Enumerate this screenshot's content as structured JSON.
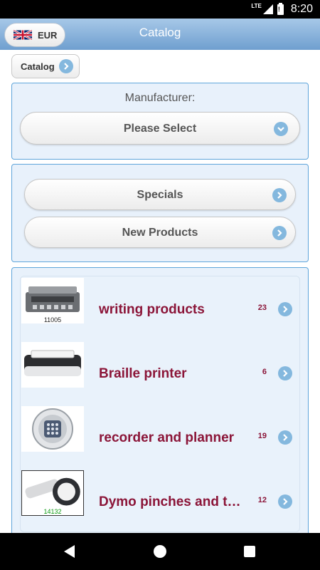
{
  "status_bar": {
    "network": "LTE",
    "battery_level": "!",
    "time": "8:20"
  },
  "app_bar": {
    "title": "Catalog",
    "currency": "EUR",
    "flag_icon": "uk-flag-icon"
  },
  "breadcrumb": {
    "label": "Catalog"
  },
  "manufacturer": {
    "label": "Manufacturer:",
    "selected": "Please Select"
  },
  "links": {
    "specials": "Specials",
    "new_products": "New Products"
  },
  "categories": [
    {
      "name": "writing products",
      "count": "23",
      "thumb_code": "11005",
      "icon": "braille-writer-icon"
    },
    {
      "name": "Braille printer",
      "count": "6",
      "thumb_code": "",
      "icon": "braille-printer-icon"
    },
    {
      "name": "recorder and planner",
      "count": "19",
      "thumb_code": "",
      "icon": "recorder-icon"
    },
    {
      "name": "Dymo pinches and ta…",
      "count": "12",
      "thumb_code": "14132",
      "icon": "dymo-labeler-icon"
    }
  ],
  "colors": {
    "accent": "#84b8de",
    "category_text": "#8b1538",
    "panel_border": "#5fa5da",
    "appbar": "#6f9fcf"
  }
}
